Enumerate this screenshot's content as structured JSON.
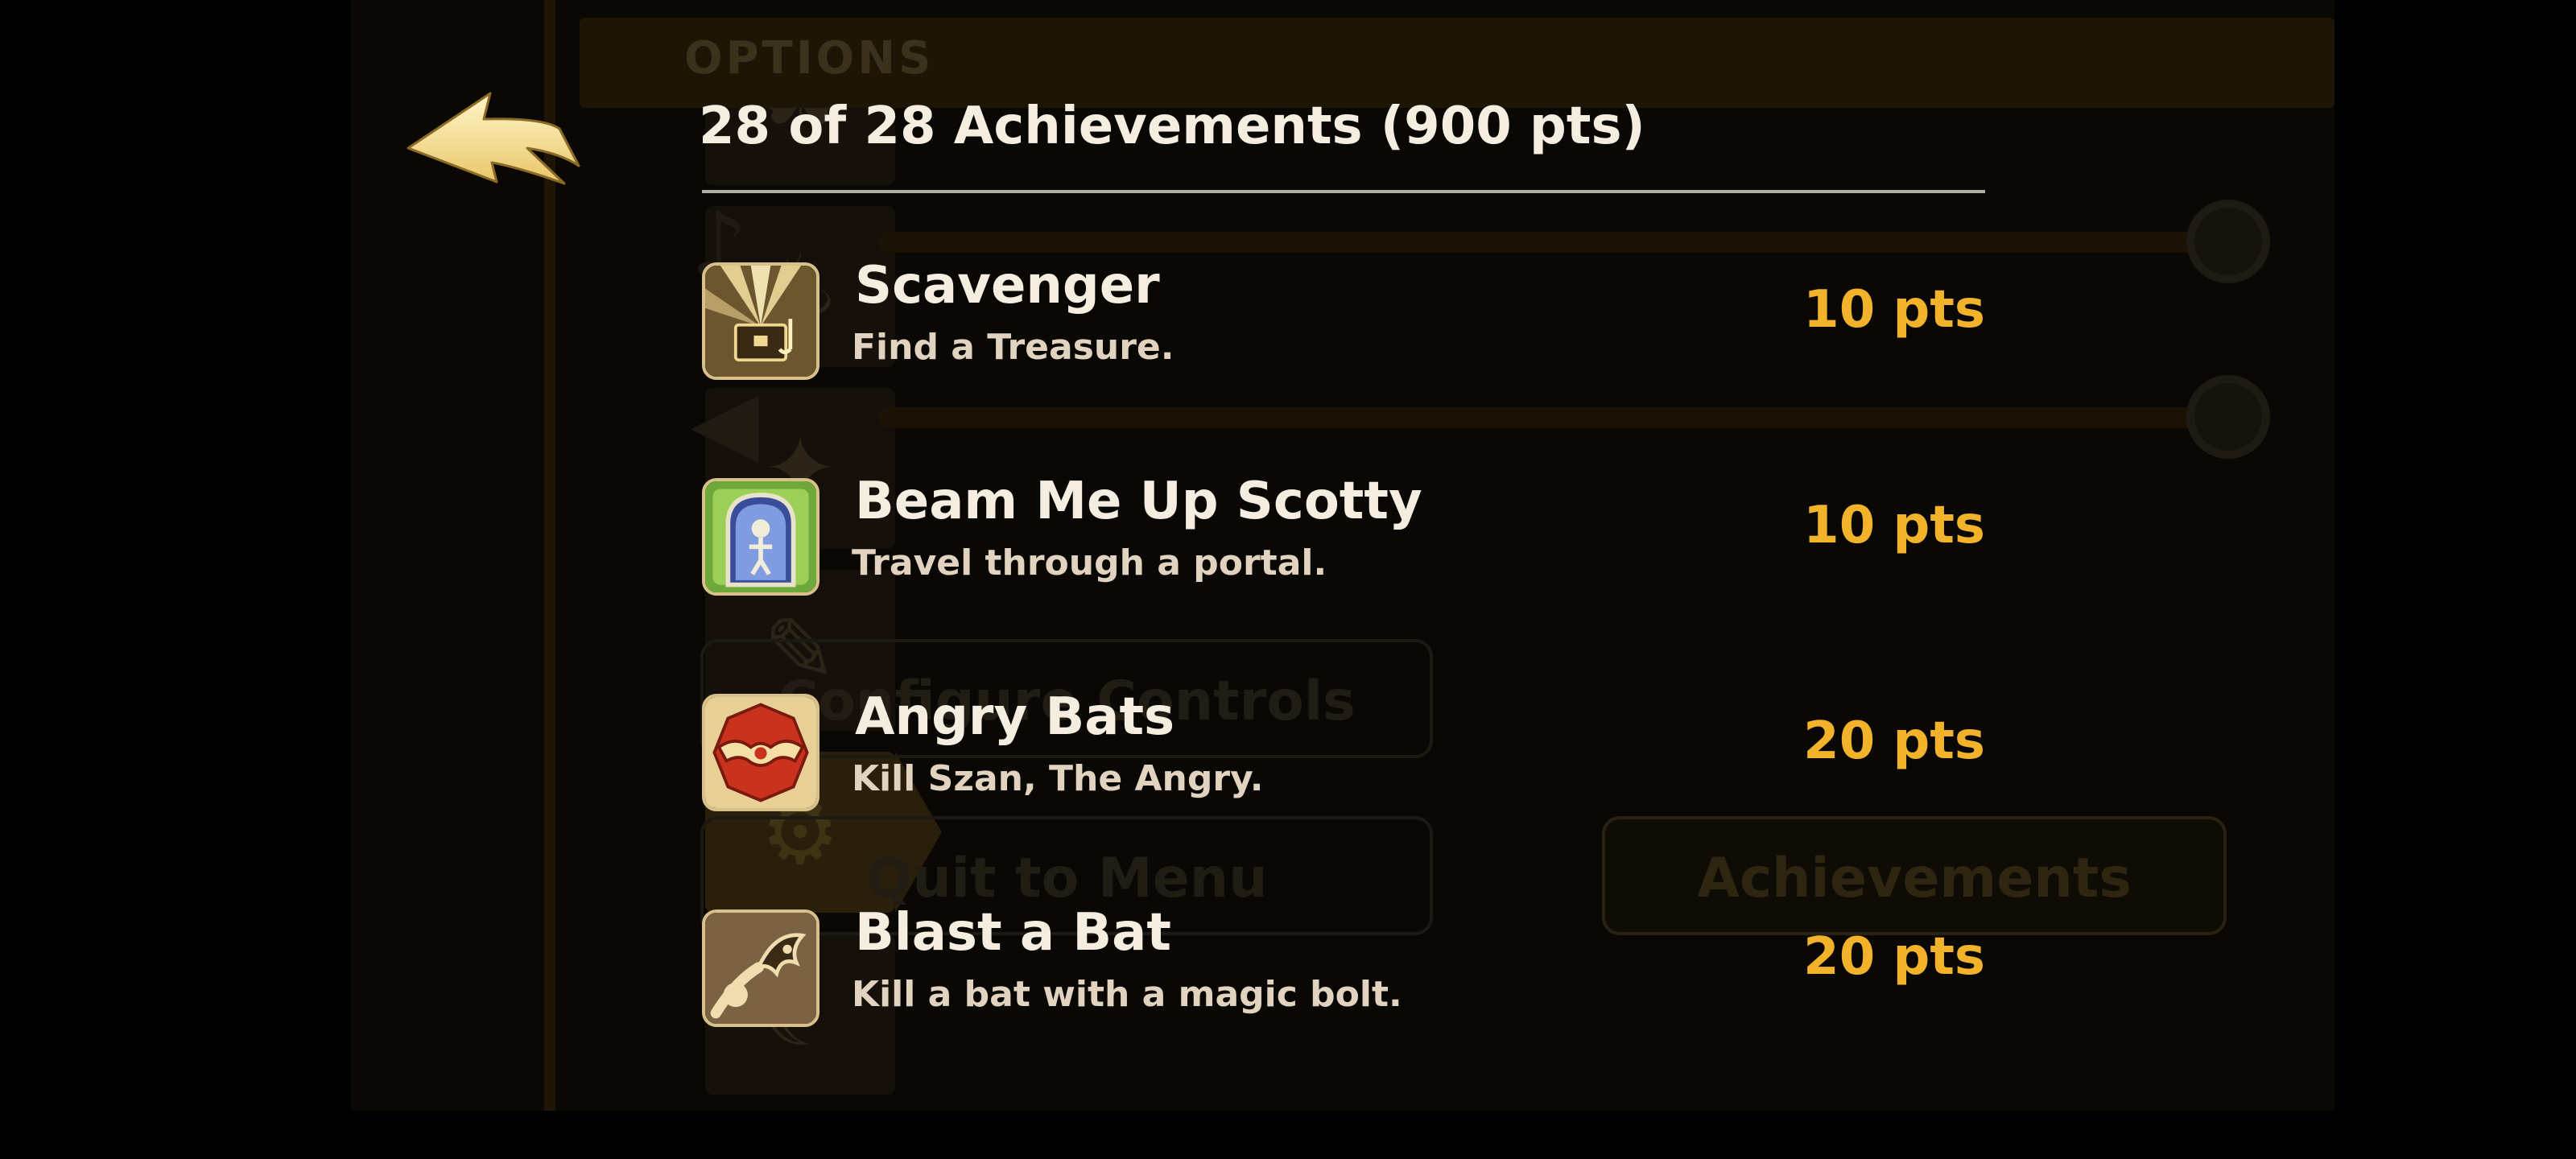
{
  "background": {
    "title": "OPTIONS",
    "buttons": {
      "configure_controls": "Configure Controls",
      "quit_to_menu": "Quit to Menu",
      "achievements": "Achievements"
    }
  },
  "overlay": {
    "back_icon": "back-arrow-icon",
    "header": "28 of 28 Achievements (900 pts)",
    "achievements": [
      {
        "icon": "treasure-chest-icon",
        "name": "Scavenger",
        "description": "Find a Treasure.",
        "points": "10 pts"
      },
      {
        "icon": "portal-icon",
        "name": "Beam Me Up Scotty",
        "description": "Travel through a portal.",
        "points": "10 pts"
      },
      {
        "icon": "bat-emblem-icon",
        "name": "Angry Bats",
        "description": "Kill Szan, The Angry.",
        "points": "20 pts"
      },
      {
        "icon": "magic-bolt-icon",
        "name": "Blast a Bat",
        "description": "Kill a bat with a magic bolt.",
        "points": "20 pts"
      }
    ]
  },
  "colors": {
    "points": "#f2b22a",
    "title_text": "#f4ede0",
    "description_text": "#e1d3bf",
    "icon_border": "#d8c08a"
  }
}
